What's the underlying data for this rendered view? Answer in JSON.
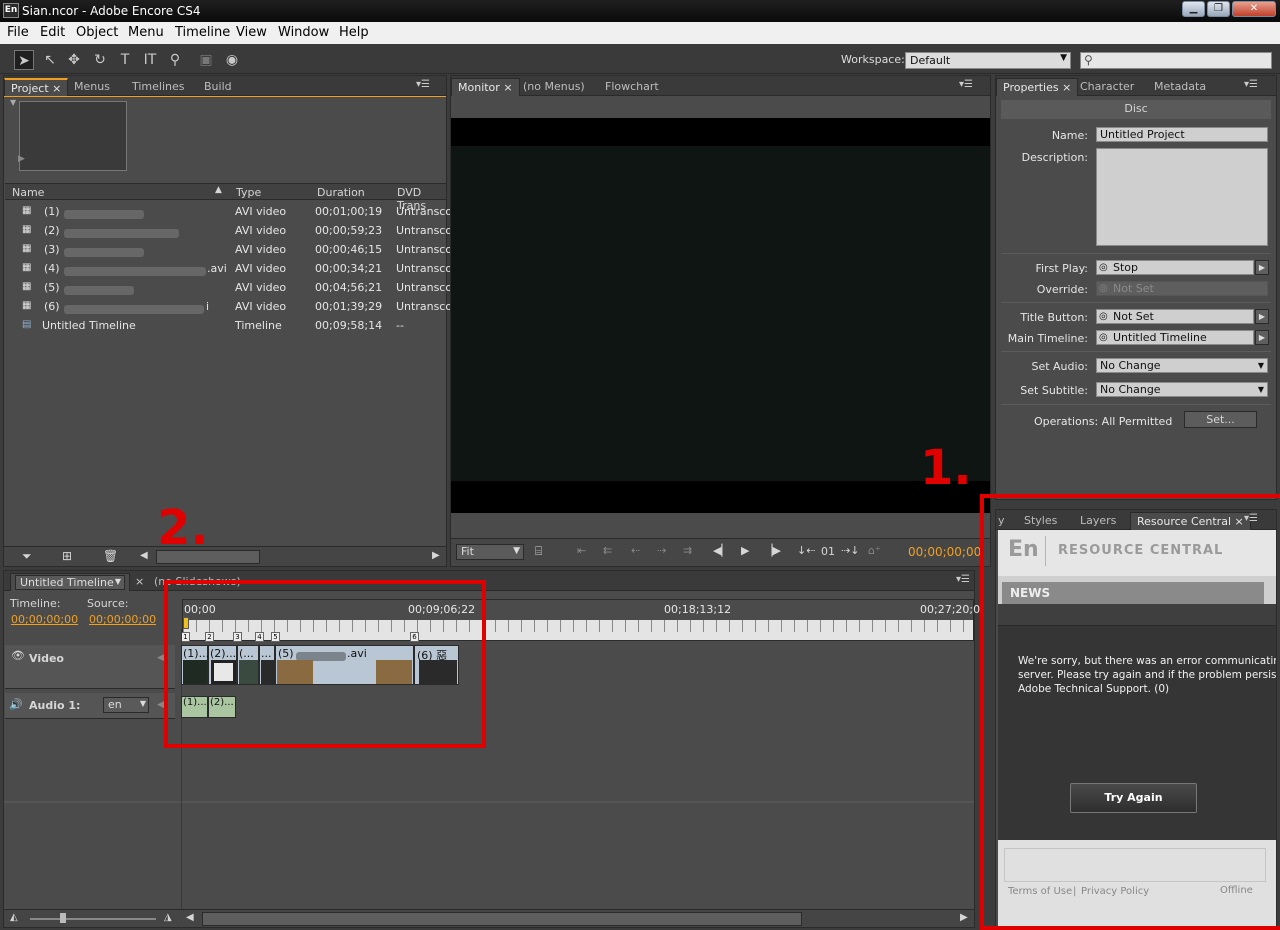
{
  "window": {
    "title": "Sian.ncor - Adobe Encore CS4",
    "app_icon": "En"
  },
  "menu": [
    "File",
    "Edit",
    "Object",
    "Menu",
    "Timeline",
    "View",
    "Window",
    "Help"
  ],
  "toolbar": {
    "workspace_label": "Workspace:",
    "workspace_value": "Default",
    "search_placeholder": ""
  },
  "project_panel": {
    "tabs": [
      "Project",
      "Menus",
      "Timelines",
      "Build"
    ],
    "columns": [
      "Name",
      "Type",
      "Duration",
      "DVD Trans"
    ],
    "rows": [
      {
        "name": "(1)",
        "name_suffix": "",
        "type": "AVI video",
        "duration": "00;01;00;19",
        "dvd": "Untransco"
      },
      {
        "name": "(2)",
        "name_suffix": "",
        "type": "AVI video",
        "duration": "00;00;59;23",
        "dvd": "Untransco"
      },
      {
        "name": "(3)",
        "name_suffix": "",
        "type": "AVI video",
        "duration": "00;00;46;15",
        "dvd": "Untransco"
      },
      {
        "name": "(4)",
        "name_suffix": ".avi",
        "type": "AVI video",
        "duration": "00;00;34;21",
        "dvd": "Untransco"
      },
      {
        "name": "(5)",
        "name_suffix": "",
        "type": "AVI video",
        "duration": "00;04;56;21",
        "dvd": "Untransco"
      },
      {
        "name": "(6)",
        "name_suffix": "i",
        "type": "AVI video",
        "duration": "00;01;39;29",
        "dvd": "Untransco"
      },
      {
        "name": "Untitled Timeline",
        "name_suffix": "",
        "type": "Timeline",
        "duration": "00;09;58;14",
        "dvd": "--"
      }
    ]
  },
  "monitor_panel": {
    "tabs": [
      "Monitor",
      "(no Menus)",
      "Flowchart"
    ],
    "fit_value": "Fit",
    "chapter_value": "01",
    "timecode": "00;00;00;00"
  },
  "properties_panel": {
    "tabs": [
      "Properties",
      "Character",
      "Metadata"
    ],
    "section_title": "Disc",
    "name_label": "Name:",
    "name_value": "Untitled Project",
    "description_label": "Description:",
    "first_play_label": "First Play:",
    "first_play_value": "Stop",
    "override_label": "Override:",
    "override_value": "Not Set",
    "title_button_label": "Title Button:",
    "title_button_value": "Not Set",
    "main_timeline_label": "Main Timeline:",
    "main_timeline_value": "Untitled Timeline",
    "set_audio_label": "Set Audio:",
    "set_audio_value": "No Change",
    "set_subtitle_label": "Set Subtitle:",
    "set_subtitle_value": "No Change",
    "operations_text": "Operations: All Permitted",
    "set_button": "Set..."
  },
  "resource_panel": {
    "tabs": [
      "y",
      "Styles",
      "Layers",
      "Resource Central"
    ],
    "logo": "En",
    "header": "RESOURCE CENTRAL",
    "news_label": "NEWS",
    "error_line1": "We're sorry, but there was an error communicating wit",
    "error_line2": "server.  Please try again and if the problem persists, co",
    "error_line3": "Adobe Technical Support. (0)",
    "try_again": "Try Again",
    "terms": "Terms of Use",
    "privacy": "Privacy Policy",
    "offline": "Offline"
  },
  "timeline_panel": {
    "tab_label": "Untitled Timeline",
    "tab2_label": "(no Slideshows)",
    "timeline_label": "Timeline:",
    "source_label": "Source:",
    "timeline_tc": "00;00;00;00",
    "source_tc": "00;00;00;00",
    "ruler": [
      "00;00",
      "00;09;06;22",
      "00;18;13;12",
      "00;27;20;0"
    ],
    "video_track": "Video",
    "audio_track": "Audio 1:",
    "audio_lang": "en",
    "video_clips": [
      "(1)...",
      "(2)...",
      "(...",
      "...",
      "(5)",
      ".avi",
      "(6) 惡"
    ],
    "audio_clips": [
      "(1)...",
      "(2)..."
    ],
    "markers": [
      "1",
      "2",
      "3",
      "4",
      "5",
      "6"
    ]
  },
  "annotations": {
    "label1": "1.",
    "label2": "2."
  },
  "colors": {
    "highlight_orange": "#f0a020",
    "annotation_red": "#e00000",
    "panel_bg": "#4b4b4b"
  }
}
